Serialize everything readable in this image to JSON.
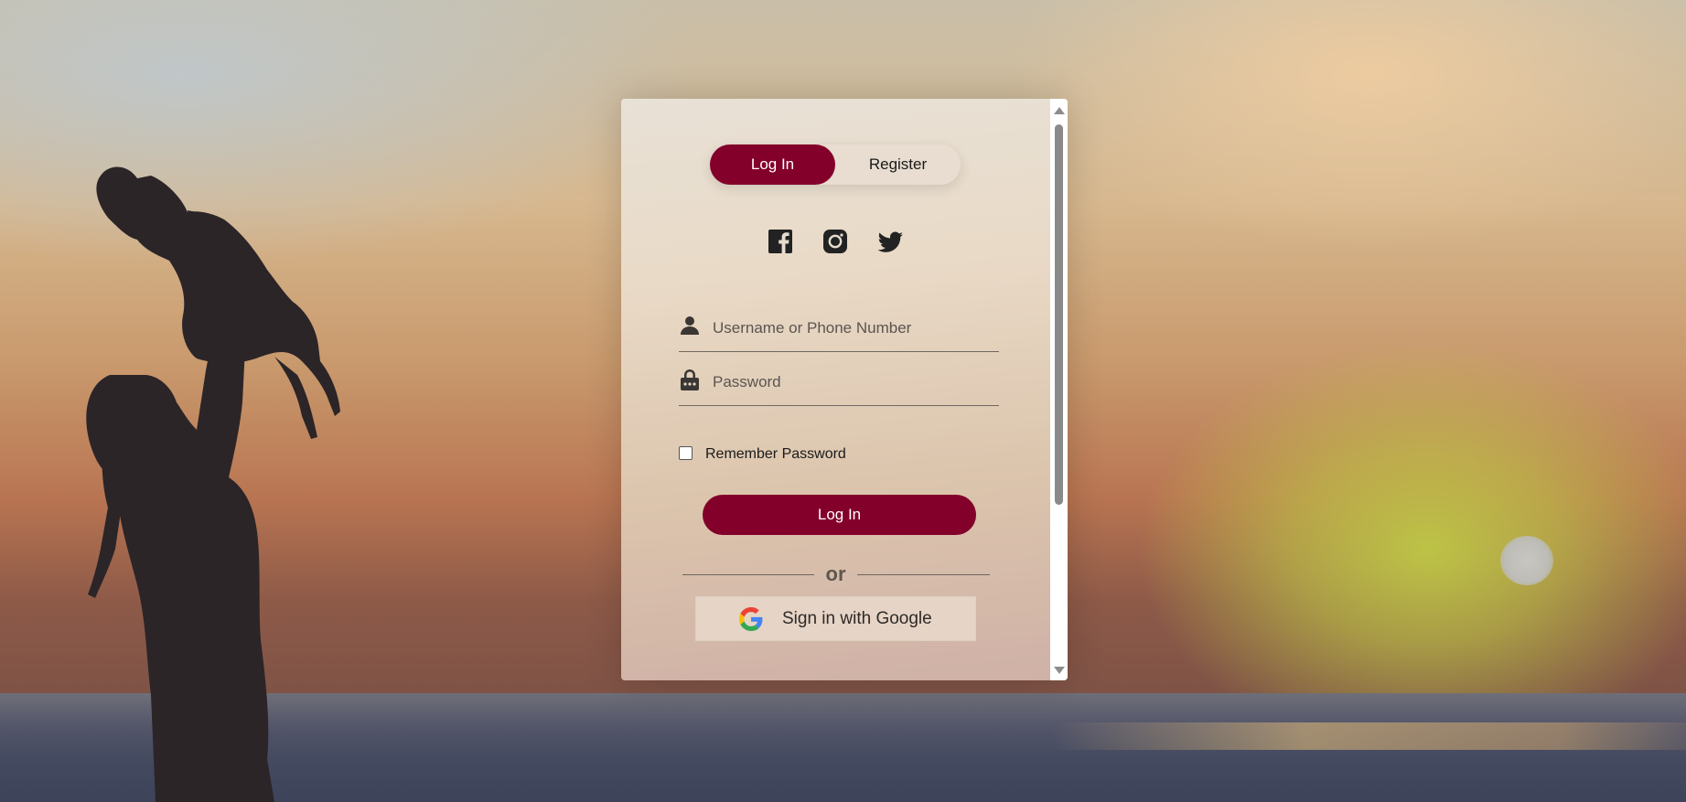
{
  "auth_toggle": {
    "login_label": "Log In",
    "register_label": "Register"
  },
  "social": {
    "icons": [
      "facebook-icon",
      "instagram-icon",
      "twitter-icon"
    ]
  },
  "form": {
    "username_placeholder": "Username or Phone Number",
    "password_placeholder": "Password",
    "remember_label": "Remember Password",
    "remember_checked": false,
    "submit_label": "Log In",
    "divider_label": "or",
    "google_label": "Sign in with Google"
  },
  "colors": {
    "accent": "#83002a"
  }
}
